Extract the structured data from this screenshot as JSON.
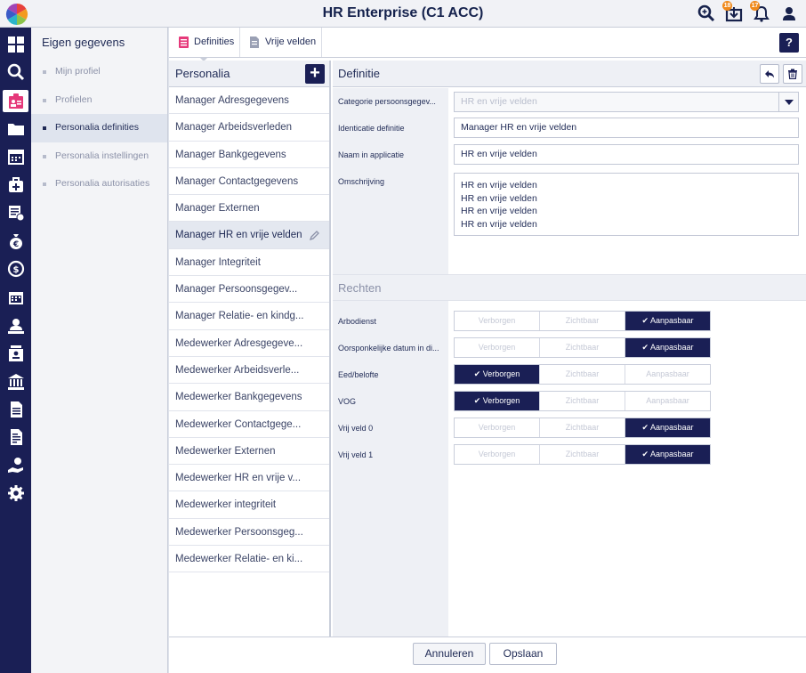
{
  "app": {
    "title": "HR Enterprise (C1 ACC)"
  },
  "topbar": {
    "badges": {
      "inbox": "18",
      "notifications": "17"
    }
  },
  "subnav": {
    "header": "Eigen gegevens",
    "items": [
      {
        "label": "Mijn profiel"
      },
      {
        "label": "Profielen"
      },
      {
        "label": "Personalia definities"
      },
      {
        "label": "Personalia instellingen"
      },
      {
        "label": "Personalia autorisaties"
      }
    ]
  },
  "tabs": [
    {
      "label": "Definities"
    },
    {
      "label": "Vrije velden"
    }
  ],
  "help_label": "?",
  "personalia": {
    "header": "Personalia",
    "add_label": "+",
    "items": [
      "Manager Adresgegevens",
      "Manager Arbeidsverleden",
      "Manager Bankgegevens",
      "Manager Contactgegevens",
      "Manager Externen",
      "Manager HR en vrije velden",
      "Manager Integriteit",
      "Manager Persoonsgegev...",
      "Manager Relatie- en kindg...",
      "Medewerker Adresgegeve...",
      "Medewerker Arbeidsverle...",
      "Medewerker Bankgegevens",
      "Medewerker Contactgege...",
      "Medewerker Externen",
      "Medewerker HR en vrije v...",
      "Medewerker integriteit",
      "Medewerker Persoonsgeg...",
      "Medewerker Relatie- en ki..."
    ]
  },
  "definitie": {
    "header": "Definitie",
    "fields": {
      "categorie": {
        "label": "Categorie persoonsgegev...",
        "value": "HR en vrije velden"
      },
      "identicatie": {
        "label": "Identicatie definitie",
        "value": "Manager HR en vrije velden"
      },
      "naam": {
        "label": "Naam in applicatie",
        "value": "HR en vrije velden"
      },
      "omschrijving": {
        "label": "Omschrijving",
        "value": "HR en vrije velden\nHR en vrije velden\nHR en vrije velden\nHR en vrije velden"
      }
    },
    "rechten_header": "Rechten",
    "options": {
      "verborgen": "Verborgen",
      "zichtbaar": "Zichtbaar",
      "aanpasbaar": "Aanpasbaar"
    },
    "rechten": [
      {
        "label": "Arbodienst",
        "selected": "Aanpasbaar"
      },
      {
        "label": "Oorsponkelijke datum in di...",
        "selected": "Aanpasbaar"
      },
      {
        "label": "Eed/belofte",
        "selected": "Verborgen"
      },
      {
        "label": "VOG",
        "selected": "Verborgen"
      },
      {
        "label": "Vrij veld 0",
        "selected": "Aanpasbaar"
      },
      {
        "label": "Vrij veld 1",
        "selected": "Aanpasbaar"
      }
    ]
  },
  "footer": {
    "cancel_label": "Annuleren",
    "save_label": "Opslaan"
  },
  "colors": {
    "navy": "#1a1f55",
    "badge": "#f08a1c"
  }
}
